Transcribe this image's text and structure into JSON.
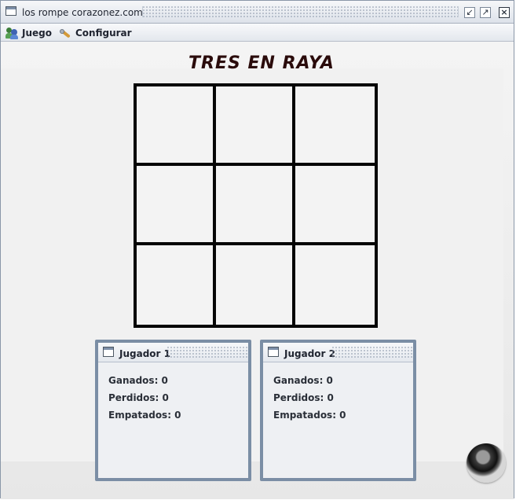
{
  "window": {
    "title": "los rompe corazonez.com",
    "icons": {
      "app": "window-icon",
      "restore": "restore-icon",
      "maximize": "maximize-icon",
      "close": "close-icon"
    }
  },
  "menu": {
    "items": [
      {
        "label": "Juego",
        "icon": "users-icon"
      },
      {
        "label": "Configurar",
        "icon": "tools-icon"
      }
    ]
  },
  "game": {
    "title": "TRES EN RAYA",
    "board": [
      "",
      "",
      "",
      "",
      "",
      "",
      "",
      "",
      ""
    ]
  },
  "players": [
    {
      "title": "Jugador 1",
      "stats": [
        "Ganados: 0",
        "Perdidos: 0",
        "Empatados: 0"
      ]
    },
    {
      "title": "Jugador 2",
      "stats": [
        "Ganados: 0",
        "Perdidos: 0",
        "Empatados: 0"
      ]
    }
  ],
  "speaker": {
    "icon": "speaker-icon"
  }
}
